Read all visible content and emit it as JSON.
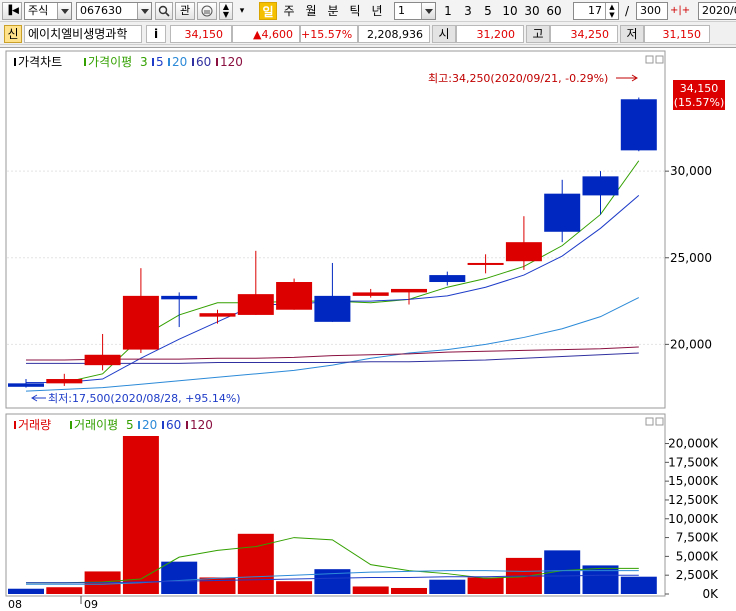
{
  "toolbar": {
    "market": "주식",
    "code": "067630",
    "search_btn": "관",
    "periods": [
      "일",
      "주",
      "월",
      "분",
      "틱",
      "년"
    ],
    "interval": "1",
    "quick_counts": [
      "1",
      "3",
      "5",
      "10",
      "30",
      "60"
    ],
    "view_count": "17",
    "slash": "/",
    "total_count": "300",
    "date": "2020/0"
  },
  "quote": {
    "credit_badge": "신",
    "name": "에이치엘비생명과학",
    "info_btn": "i",
    "price": "34,150",
    "change": "▲4,600",
    "change_rate": "+15.57%",
    "volume": "2,208,936",
    "open_label": "시",
    "open": "31,200",
    "high_label": "고",
    "high": "34,250",
    "low_label": "저",
    "low": "31,150"
  },
  "price_panel": {
    "title": "가격차트",
    "ma_title": "가격이평",
    "ma_periods": [
      "3",
      "5",
      "20",
      "60",
      "120"
    ],
    "ma_colors": [
      "#33a000",
      "#1e3cc8",
      "#2c8ad8",
      "#8a1040",
      "#3030a0"
    ],
    "y_ticks": [
      20000,
      25000,
      30000
    ],
    "y_tick_labels": [
      "20,000",
      "25,000",
      "30,000"
    ],
    "current_label": "34,150",
    "current_rate": "(15.57%)",
    "high_annotation": "최고:34,250(2020/09/21, -0.29%)",
    "low_annotation": "최저:17,500(2020/08/28, +95.14%)"
  },
  "volume_panel": {
    "title": "거래량",
    "ma_title": "거래이평",
    "ma_periods": [
      "5",
      "20",
      "60",
      "120"
    ],
    "ma_colors": [
      "#33a000",
      "#2c8ad8",
      "#1e3cc8",
      "#8a1040"
    ],
    "y_tick_labels": [
      "20,000K",
      "17,500K",
      "15,000K",
      "12,500K",
      "10,000K",
      "7,500K",
      "5,000K",
      "2,500K",
      "0K"
    ]
  },
  "x_axis": {
    "labels": [
      "08",
      "09"
    ]
  },
  "chart_data": {
    "type": "candlestick",
    "price": {
      "ylim": [
        16500,
        34800
      ],
      "candles": [
        {
          "o": 17750,
          "h": 18000,
          "l": 17500,
          "c": 17550
        },
        {
          "o": 17750,
          "h": 18300,
          "l": 17600,
          "c": 18000
        },
        {
          "o": 18800,
          "h": 20600,
          "l": 18500,
          "c": 19400
        },
        {
          "o": 19700,
          "h": 24400,
          "l": 19500,
          "c": 22800
        },
        {
          "o": 22800,
          "h": 23000,
          "l": 21000,
          "c": 22600
        },
        {
          "o": 21600,
          "h": 22000,
          "l": 21200,
          "c": 21800
        },
        {
          "o": 21700,
          "h": 25400,
          "l": 21700,
          "c": 22900
        },
        {
          "o": 22000,
          "h": 23800,
          "l": 22000,
          "c": 23600
        },
        {
          "o": 22800,
          "h": 24700,
          "l": 21300,
          "c": 21300
        },
        {
          "o": 22800,
          "h": 23200,
          "l": 22700,
          "c": 23000
        },
        {
          "o": 23000,
          "h": 23200,
          "l": 22300,
          "c": 23200
        },
        {
          "o": 24000,
          "h": 24200,
          "l": 23400,
          "c": 23600
        },
        {
          "o": 24700,
          "h": 25200,
          "l": 24100,
          "c": 24700
        },
        {
          "o": 24800,
          "h": 27400,
          "l": 24300,
          "c": 25900
        },
        {
          "o": 28700,
          "h": 29500,
          "l": 25900,
          "c": 26500
        },
        {
          "o": 29700,
          "h": 30000,
          "l": 27500,
          "c": 28600
        },
        {
          "o": 34150,
          "h": 34250,
          "l": 31150,
          "c": 31200
        }
      ],
      "ma": {
        "3": [
          17800,
          17800,
          18300,
          20400,
          21700,
          22400,
          22400,
          22500,
          22500,
          22400,
          22600,
          23300,
          23800,
          24500,
          25700,
          27500,
          30600
        ],
        "5": [
          17800,
          17800,
          18000,
          19200,
          20300,
          21300,
          22300,
          22300,
          22500,
          22500,
          22600,
          22800,
          23300,
          24000,
          25100,
          26700,
          28600
        ],
        "20": [
          17300,
          17400,
          17500,
          17700,
          17900,
          18100,
          18300,
          18500,
          18800,
          19200,
          19500,
          19700,
          20000,
          20400,
          20900,
          21600,
          22700
        ],
        "60": [
          19100,
          19100,
          19150,
          19150,
          19150,
          19200,
          19200,
          19250,
          19350,
          19400,
          19450,
          19550,
          19600,
          19650,
          19700,
          19750,
          19850
        ],
        "120": [
          18900,
          18900,
          18900,
          18900,
          18900,
          18950,
          18950,
          18950,
          18950,
          19000,
          19000,
          19050,
          19100,
          19200,
          19300,
          19400,
          19500
        ]
      }
    },
    "volume": {
      "ylim": [
        0,
        21000
      ],
      "values": [
        700,
        900,
        3000,
        21000,
        4300,
        2200,
        8000,
        1700,
        3300,
        1000,
        800,
        1900,
        2200,
        4800,
        5800,
        3800,
        2300
      ],
      "ma": {
        "5": [
          1500,
          1500,
          1600,
          2000,
          4900,
          5800,
          6300,
          7500,
          7200,
          3900,
          3100,
          2700,
          2100,
          2300,
          3100,
          3400,
          3400
        ],
        "20": [
          1300,
          1300,
          1300,
          1500,
          1800,
          2100,
          2300,
          2500,
          2700,
          2900,
          3000,
          3100,
          3100,
          3000,
          3100,
          3100,
          3100
        ],
        "60": [
          1500,
          1500,
          1500,
          1600,
          1700,
          1800,
          1900,
          2000,
          2100,
          2200,
          2200,
          2300,
          2300,
          2400,
          2400,
          2500,
          2500
        ]
      }
    },
    "up_color": "#dc0000",
    "down_color": "#0028c0"
  }
}
